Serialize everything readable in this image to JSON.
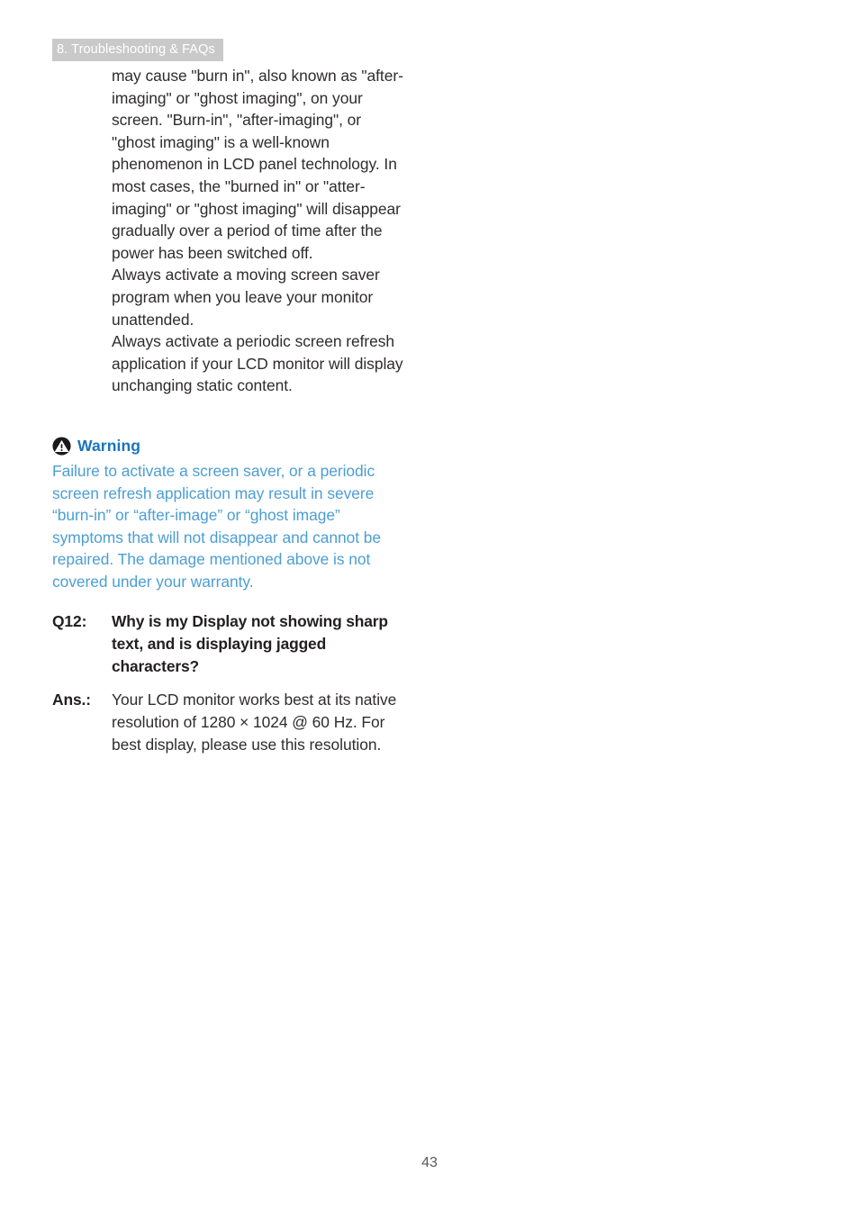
{
  "header": {
    "section_label": "8. Troubleshooting & FAQs"
  },
  "body": {
    "paragraphs": [
      "may cause \"burn in\", also known as \"after-imaging\" or \"ghost imaging\", on your screen. \"Burn-in\", \"after-imaging\", or \"ghost imaging\" is a well-known phenomenon in LCD panel technology. In most cases, the \"burned in\" or \"atter-imaging\" or \"ghost imaging\" will disappear gradually over a period of time after the power has been switched off.",
      "Always activate a moving screen saver program when you leave your monitor unattended.",
      "Always activate a periodic screen refresh application if your LCD monitor will display unchanging static content."
    ]
  },
  "warning": {
    "icon": "warning-triangle-icon",
    "title": "Warning",
    "text": "Failure to activate a screen saver, or a periodic screen refresh application may result in severe “burn-in” or “after-image” or “ghost image” symptoms that will not disappear and cannot be repaired. The damage mentioned above is not covered under your warranty.",
    "title_color": "#1b75bb",
    "text_color": "#4c9ed4"
  },
  "faq": {
    "question_label": "Q12:",
    "question_text": "Why is my Display not showing sharp text, and is displaying jagged characters?",
    "answer_label": "Ans.:",
    "answer_text": "Your LCD monitor works best at its native resolution of 1280 × 1024 @ 60 Hz. For best display, please use this resolution."
  },
  "footer": {
    "page_number": "43"
  }
}
